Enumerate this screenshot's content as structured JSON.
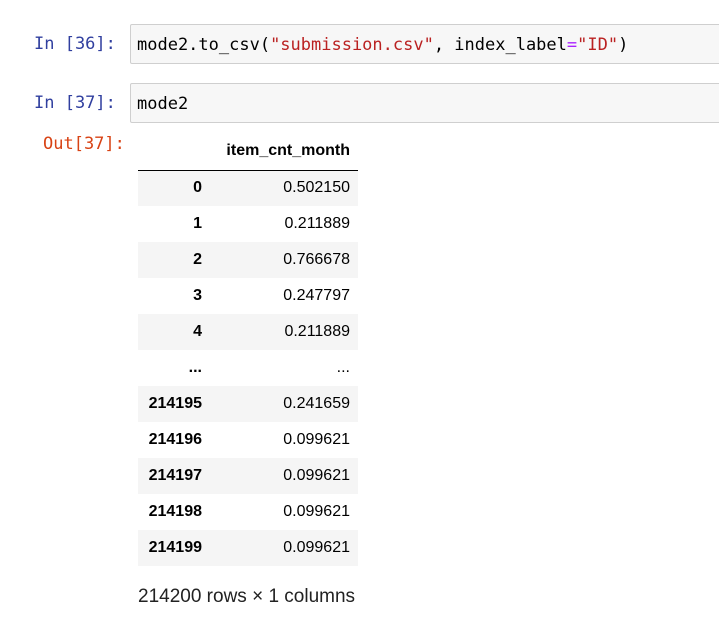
{
  "cells": [
    {
      "prompt": "In [36]:",
      "code_parts": {
        "p1": "mode2.to_csv(",
        "s1": "\"submission.csv\"",
        "p2": ", index_label",
        "eq": "=",
        "s2": "\"ID\"",
        "p3": ")"
      }
    },
    {
      "prompt": "In [37]:",
      "code": "mode2"
    }
  ],
  "output": {
    "prompt": "Out[37]:",
    "table": {
      "columns": [
        "item_cnt_month"
      ],
      "rows": [
        {
          "index": "0",
          "value": "0.502150"
        },
        {
          "index": "1",
          "value": "0.211889"
        },
        {
          "index": "2",
          "value": "0.766678"
        },
        {
          "index": "3",
          "value": "0.247797"
        },
        {
          "index": "4",
          "value": "0.211889"
        },
        {
          "index": "...",
          "value": "..."
        },
        {
          "index": "214195",
          "value": "0.241659"
        },
        {
          "index": "214196",
          "value": "0.099621"
        },
        {
          "index": "214197",
          "value": "0.099621"
        },
        {
          "index": "214198",
          "value": "0.099621"
        },
        {
          "index": "214199",
          "value": "0.099621"
        }
      ]
    },
    "shape": "214200 rows × 1 columns"
  }
}
